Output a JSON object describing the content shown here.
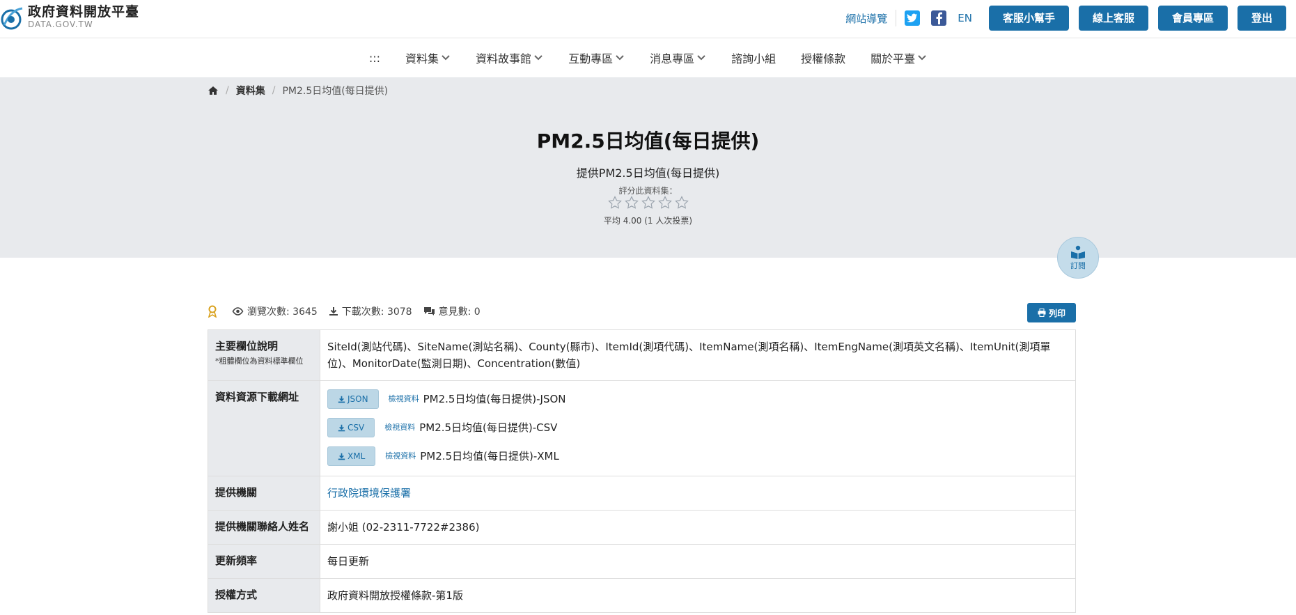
{
  "header": {
    "logo_cn": "政府資料開放平臺",
    "logo_en": "DATA.GOV.TW",
    "sitemap": "網站導覽",
    "lang": "EN",
    "buttons": [
      "客服小幫手",
      "線上客服",
      "會員專區",
      "登出"
    ]
  },
  "nav": {
    "accessibility": ":::",
    "items": [
      {
        "label": "資料集",
        "dropdown": true
      },
      {
        "label": "資料故事館",
        "dropdown": true
      },
      {
        "label": "互動專區",
        "dropdown": true
      },
      {
        "label": "消息專區",
        "dropdown": true
      },
      {
        "label": "諮詢小組",
        "dropdown": false
      },
      {
        "label": "授權條款",
        "dropdown": false
      },
      {
        "label": "關於平臺",
        "dropdown": true
      }
    ]
  },
  "breadcrumb": {
    "items": [
      "資料集",
      "PM2.5日均值(每日提供)"
    ]
  },
  "dataset": {
    "title": "PM2.5日均值(每日提供)",
    "subtitle": "提供PM2.5日均值(每日提供)",
    "rate_label": "評分此資料集：",
    "stars_total": 5,
    "rate_avg": "平均 4.00 (1 人次投票)",
    "subscribe": "訂閱"
  },
  "stats": {
    "views": "瀏覽次數: 3645",
    "downloads": "下載次數: 3078",
    "comments": "意見數: 0",
    "print": "列印"
  },
  "info": {
    "fields_label": "主要欄位說明",
    "fields_note": "*粗體欄位為資料標準欄位",
    "fields_value": "SiteId(測站代碼)、SiteName(測站名稱)、County(縣市)、ItemId(測項代碼)、ItemName(測項名稱)、ItemEngName(測項英文名稱)、ItemUnit(測項單位)、MonitorDate(監測日期)、Concentration(數值)",
    "resources_label": "資料資源下載網址",
    "preview_label": "檢視資料",
    "resources": [
      {
        "format": "JSON",
        "name": "PM2.5日均值(每日提供)-JSON"
      },
      {
        "format": "CSV",
        "name": "PM2.5日均值(每日提供)-CSV"
      },
      {
        "format": "XML",
        "name": "PM2.5日均值(每日提供)-XML"
      }
    ],
    "agency_label": "提供機關",
    "agency_value": "行政院環境保護署",
    "contact_label": "提供機關聯絡人姓名",
    "contact_value": "謝小姐 (02-2311-7722#2386)",
    "frequency_label": "更新頻率",
    "frequency_value": "每日更新",
    "license_label": "授權方式",
    "license_value": "政府資料開放授權條款-第1版"
  },
  "colors": {
    "primary": "#1a6fa8",
    "hero_bg": "#e8eaed",
    "twitter": "#1da1f2",
    "facebook": "#3b5998"
  }
}
